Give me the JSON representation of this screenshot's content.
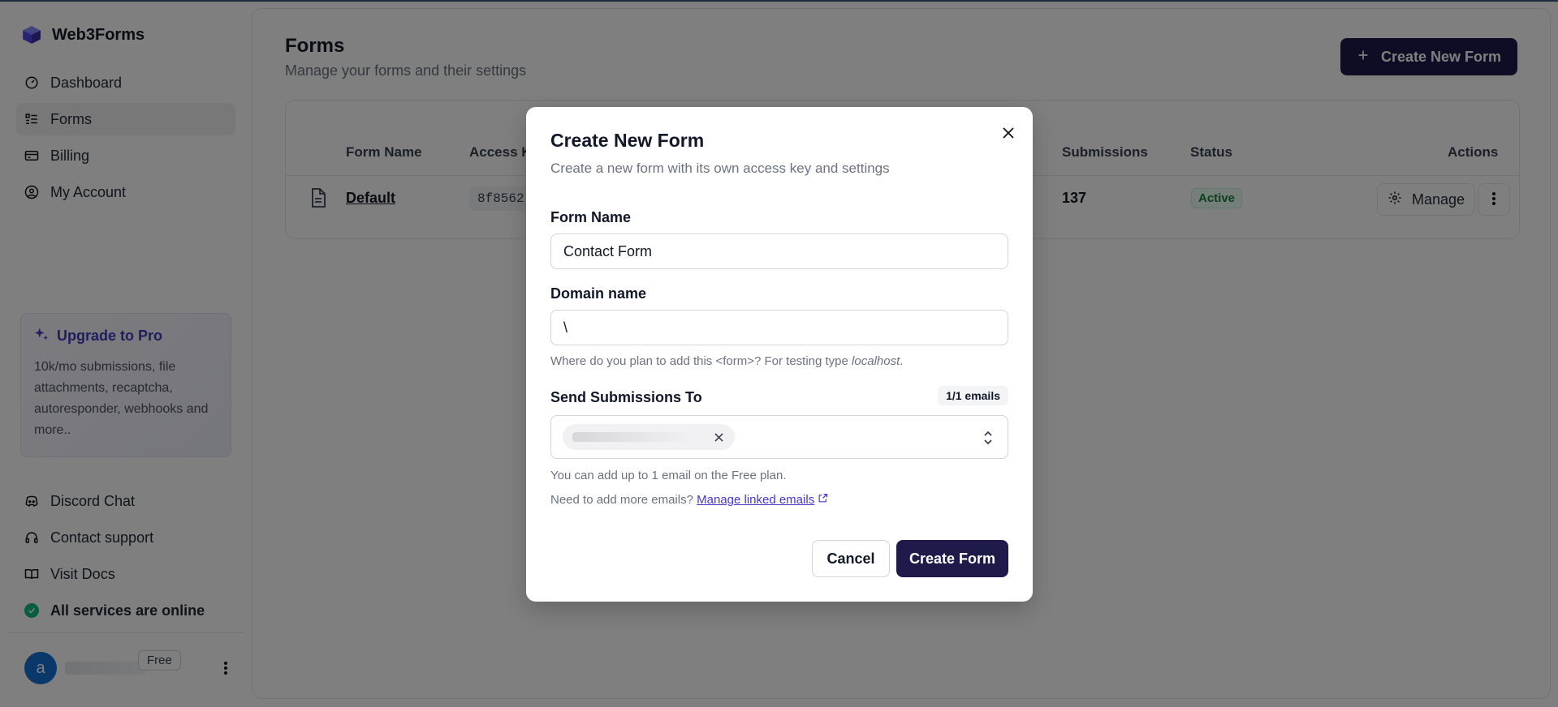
{
  "brand": {
    "name": "Web3Forms"
  },
  "sidebar": {
    "items": [
      {
        "label": "Dashboard",
        "icon": "dashboard-icon"
      },
      {
        "label": "Forms",
        "icon": "list-icon",
        "active": true
      },
      {
        "label": "Billing",
        "icon": "credit-card-icon"
      },
      {
        "label": "My Account",
        "icon": "user-circle-icon"
      }
    ],
    "upgrade": {
      "title": "Upgrade to Pro",
      "text": "10k/mo submissions, file attachments, recaptcha, autoresponder, webhooks and more.."
    },
    "bottom_items": [
      {
        "label": "Discord Chat",
        "icon": "discord-icon"
      },
      {
        "label": "Contact support",
        "icon": "headset-icon"
      },
      {
        "label": "Visit Docs",
        "icon": "book-icon"
      }
    ],
    "status": "All services are online",
    "user": {
      "initial": "a",
      "plan": "Free"
    }
  },
  "page": {
    "title": "Forms",
    "subtitle": "Manage your forms and their settings",
    "create_button": "Create New Form"
  },
  "table": {
    "headers": {
      "form_name": "Form Name",
      "access_key": "Access Ke",
      "submissions": "Submissions",
      "status": "Status",
      "actions": "Actions"
    },
    "row": {
      "name": "Default",
      "access_key": "8f8562",
      "submissions": "137",
      "status": "Active",
      "manage": "Manage"
    }
  },
  "modal": {
    "title": "Create New Form",
    "description": "Create a new form with its own access key and settings",
    "form_name_label": "Form Name",
    "form_name_value": "Contact Form",
    "domain_label": "Domain name",
    "domain_value": "\\",
    "domain_hint_prefix": "Where do you plan to add this <form>? For testing type ",
    "domain_hint_em": "localhost",
    "domain_hint_suffix": ".",
    "send_label": "Send Submissions To",
    "email_count": "1/1 emails",
    "limit_hint": "You can add up to 1 email on the Free plan.",
    "more_emails_prefix": "Need to add more emails?",
    "manage_link": "Manage linked emails",
    "cancel": "Cancel",
    "submit": "Create Form"
  },
  "colors": {
    "primary": "#1e1b4b",
    "accent": "#3f3cbb",
    "success": "#10b981"
  }
}
